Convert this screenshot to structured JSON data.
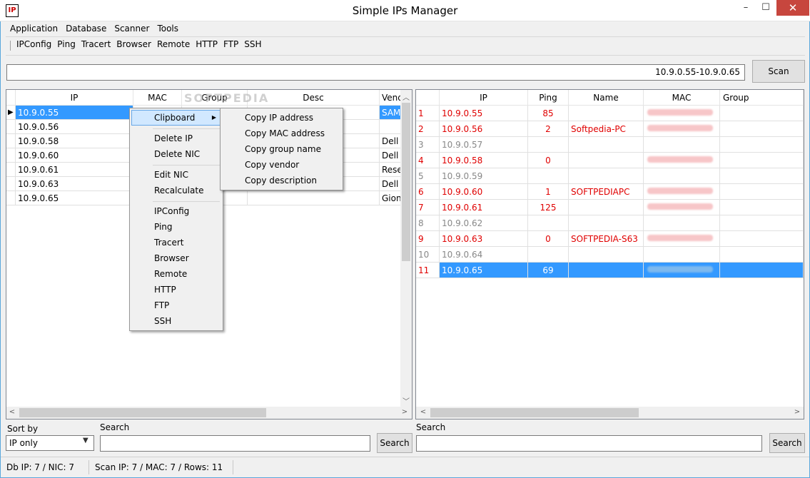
{
  "window": {
    "title": "Simple IPs Manager",
    "icon_text": "IP",
    "minimize_glyph": "–",
    "maximize_glyph": "☐",
    "close_glyph": "✕"
  },
  "menubar": [
    "Application",
    "Database",
    "Scanner",
    "Tools"
  ],
  "toolbar": [
    "IPConfig",
    "Ping",
    "Tracert",
    "Browser",
    "Remote",
    "HTTP",
    "FTP",
    "SSH"
  ],
  "scan": {
    "range_value": "10.9.0.55-10.9.0.65",
    "button_label": "Scan"
  },
  "left_table": {
    "columns": [
      "IP",
      "MAC",
      "Group",
      "Desc",
      "Vendor"
    ],
    "rows": [
      {
        "ip": "10.9.0.55",
        "vendor": "SAM"
      },
      {
        "ip": "10.9.0.56",
        "vendor": ""
      },
      {
        "ip": "10.9.0.58",
        "vendor": "Dell"
      },
      {
        "ip": "10.9.0.60",
        "vendor": "Dell"
      },
      {
        "ip": "10.9.0.61",
        "vendor": "Rese"
      },
      {
        "ip": "10.9.0.63",
        "vendor": "Dell"
      },
      {
        "ip": "10.9.0.65",
        "vendor": "Gion"
      }
    ],
    "selected_row": 0
  },
  "right_table": {
    "columns": [
      "IP",
      "Ping",
      "Name",
      "MAC",
      "Group"
    ],
    "rows": [
      {
        "n": "1",
        "ip": "10.9.0.55",
        "ping": "85",
        "name": "",
        "alive": true,
        "mac": true
      },
      {
        "n": "2",
        "ip": "10.9.0.56",
        "ping": "2",
        "name": "Softpedia-PC",
        "alive": true,
        "mac": true
      },
      {
        "n": "3",
        "ip": "10.9.0.57",
        "ping": "",
        "name": "",
        "alive": false,
        "mac": false
      },
      {
        "n": "4",
        "ip": "10.9.0.58",
        "ping": "0",
        "name": "",
        "alive": true,
        "mac": true
      },
      {
        "n": "5",
        "ip": "10.9.0.59",
        "ping": "",
        "name": "",
        "alive": false,
        "mac": false
      },
      {
        "n": "6",
        "ip": "10.9.0.60",
        "ping": "1",
        "name": "SOFTPEDIAPC",
        "alive": true,
        "mac": true
      },
      {
        "n": "7",
        "ip": "10.9.0.61",
        "ping": "125",
        "name": "",
        "alive": true,
        "mac": true
      },
      {
        "n": "8",
        "ip": "10.9.0.62",
        "ping": "",
        "name": "",
        "alive": false,
        "mac": false
      },
      {
        "n": "9",
        "ip": "10.9.0.63",
        "ping": "0",
        "name": "SOFTPEDIA-S63",
        "alive": true,
        "mac": true
      },
      {
        "n": "10",
        "ip": "10.9.0.64",
        "ping": "",
        "name": "",
        "alive": false,
        "mac": false
      },
      {
        "n": "11",
        "ip": "10.9.0.65",
        "ping": "69",
        "name": "",
        "alive": true,
        "mac": true
      }
    ],
    "selected_row": 10
  },
  "context_menu": {
    "items": [
      "Clipboard",
      "Delete IP",
      "Delete NIC",
      "Edit NIC",
      "Recalculate",
      "IPConfig",
      "Ping",
      "Tracert",
      "Browser",
      "Remote",
      "HTTP",
      "FTP",
      "SSH"
    ],
    "highlighted": "Clipboard"
  },
  "clipboard_submenu": [
    "Copy IP address",
    "Copy MAC address",
    "Copy group name",
    "Copy vendor",
    "Copy description"
  ],
  "bottom": {
    "sort_label": "Sort by",
    "sort_value": "IP only",
    "left_search_label": "Search",
    "left_search_button": "Search",
    "right_search_label": "Search",
    "right_search_button": "Search"
  },
  "status": {
    "db": "Db IP: 7 / NIC: 7",
    "scan": "Scan IP: 7 / MAC: 7 / Rows: 11"
  },
  "watermark": "SOFTPEDIA",
  "colors": {
    "selection": "#3399ff",
    "alive_text": "#e00000",
    "dead_text": "#888888",
    "close_button": "#c7463e"
  }
}
